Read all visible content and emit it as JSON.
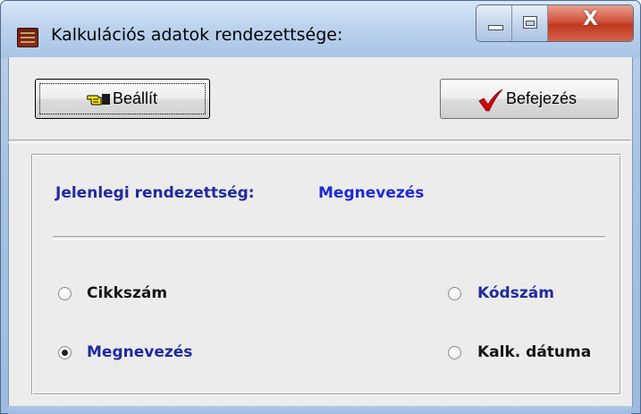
{
  "window": {
    "title": "Kalkulációs adatok rendezettsége:",
    "controls": {
      "minimize_icon": "minimize-icon",
      "maximize_icon": "maximize-icon",
      "close_glyph": "X"
    }
  },
  "toolbar": {
    "settings_label": "Beállít",
    "settings_icon": "pointing-hand-icon",
    "finish_label": "Befejezés",
    "finish_icon": "red-check-icon"
  },
  "current_sort": {
    "label": "Jelenlegi rendezettség:",
    "value": "Megnevezés"
  },
  "options": {
    "cikkszam": {
      "label": "Cikkszám",
      "selected": false
    },
    "kodszam": {
      "label": "Kódszám",
      "selected": false
    },
    "megnevezes": {
      "label": "Megnevezés",
      "selected": true
    },
    "kalk_datuma": {
      "label": "Kalk. dátuma",
      "selected": false
    }
  },
  "colors": {
    "accent_blue": "#1f2b9e",
    "value_blue": "#1d2ad6",
    "check_red": "#d40000",
    "close_red": "#c0381f"
  }
}
